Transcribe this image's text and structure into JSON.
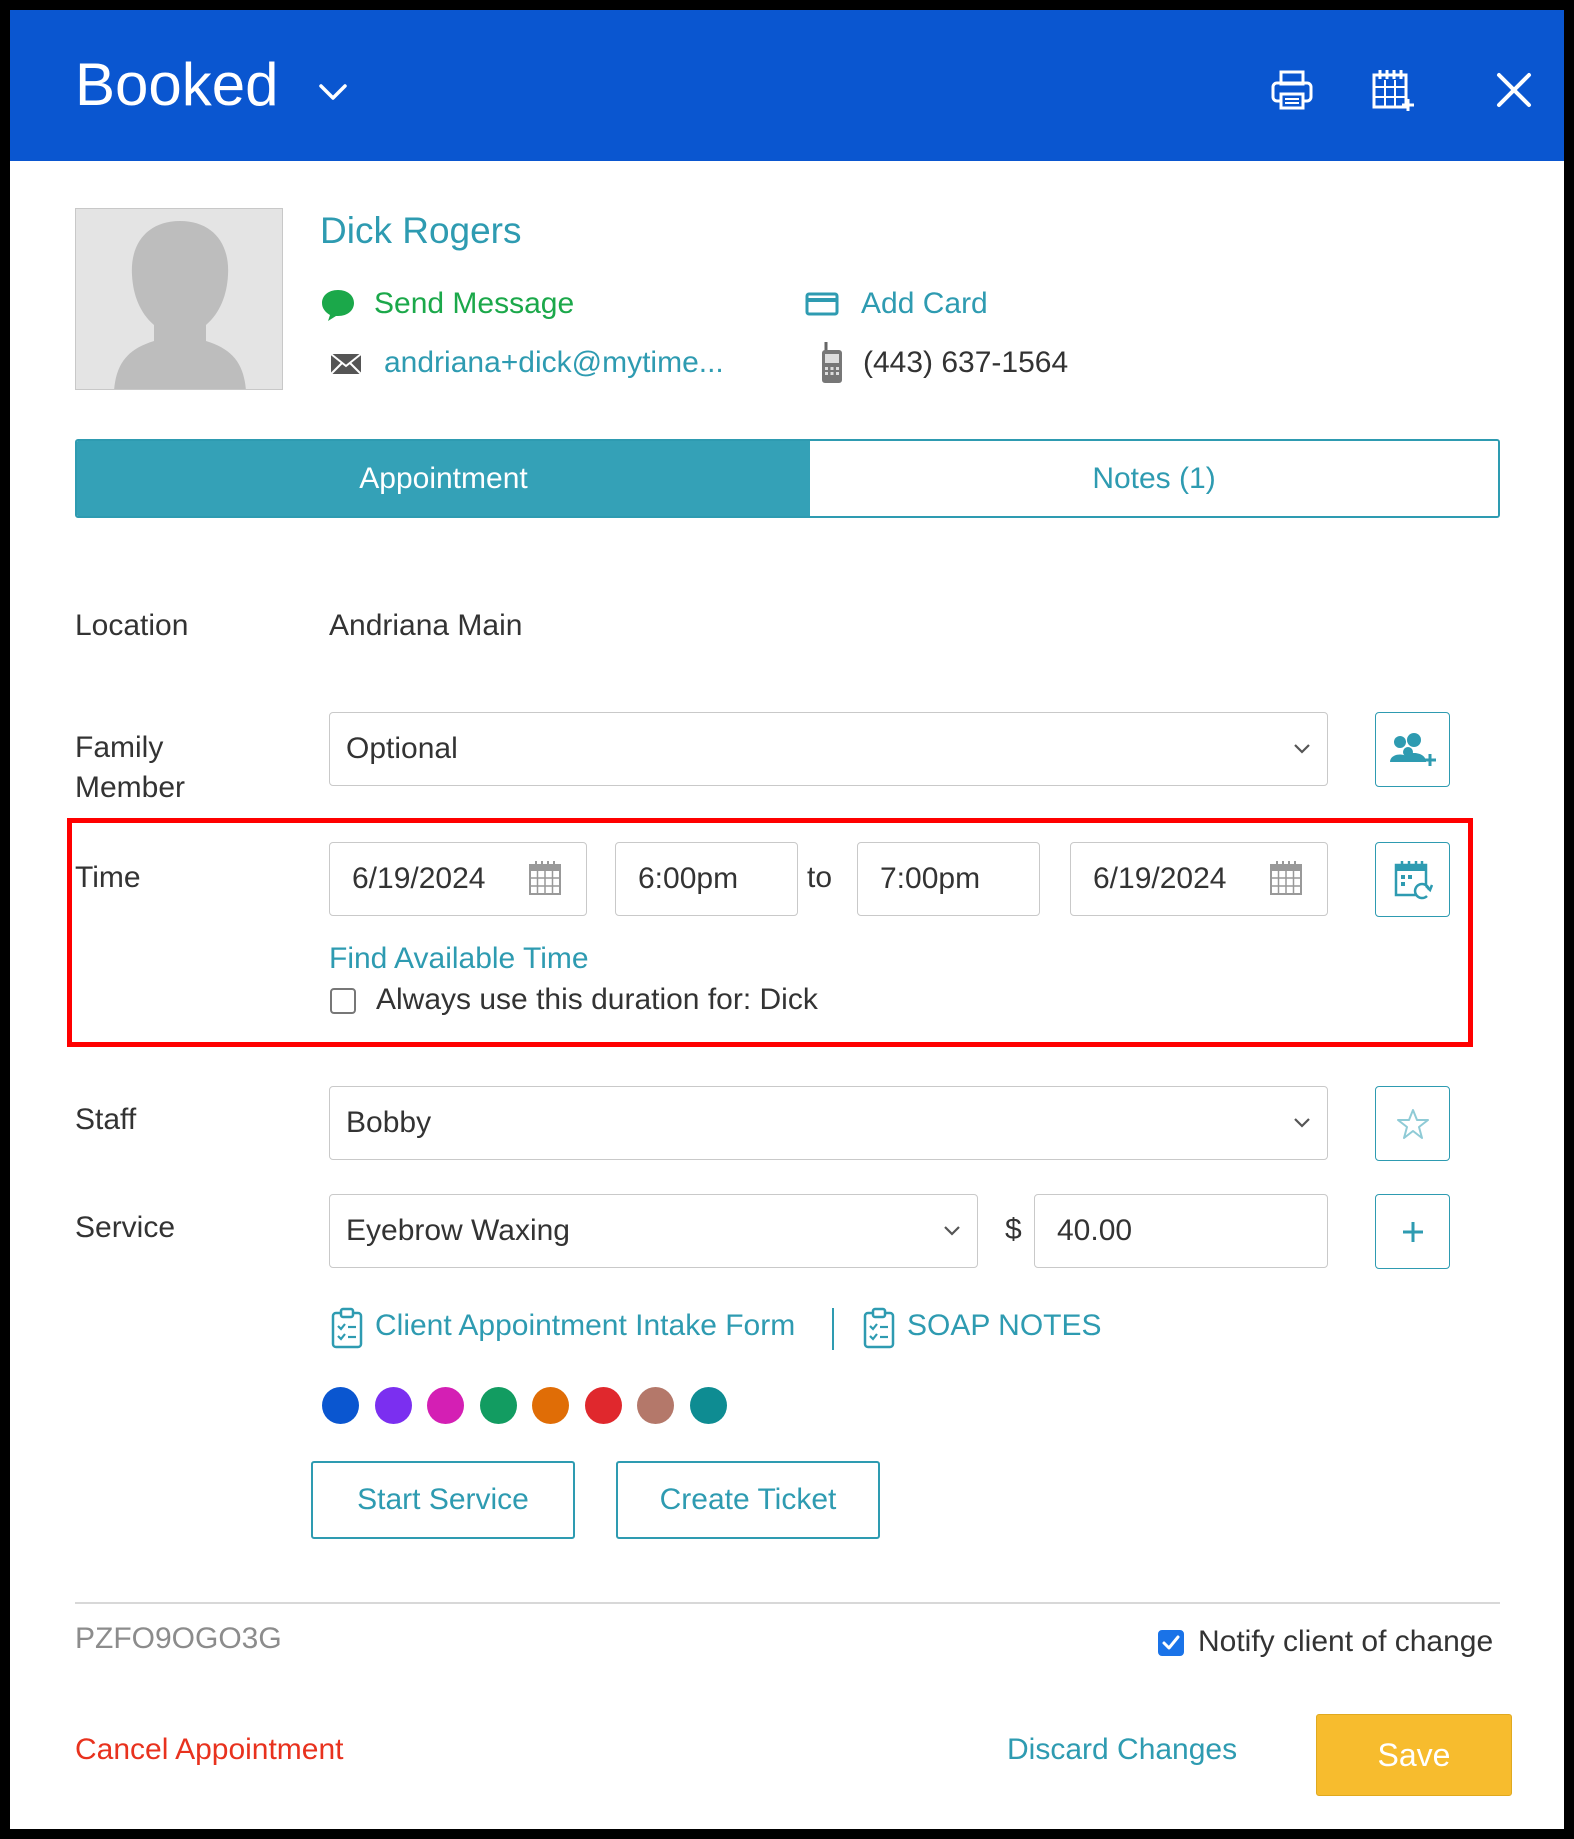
{
  "header": {
    "status": "Booked",
    "icons": [
      "chevron-down-icon",
      "print-icon",
      "calendar-add-icon",
      "close-icon"
    ]
  },
  "client": {
    "name": "Dick Rogers",
    "send_message": "Send Message",
    "add_card": "Add Card",
    "email": "andriana+dick@mytime...",
    "phone": "(443) 637-1564"
  },
  "tabs": [
    {
      "label": "Appointment",
      "active": true
    },
    {
      "label": "Notes (1)",
      "active": false
    }
  ],
  "form": {
    "location_label": "Location",
    "location_value": "Andriana Main",
    "family_label_1": "Family",
    "family_label_2": "Member",
    "family_value": "Optional",
    "time_label": "Time",
    "start_date": "6/19/2024",
    "start_time": "6:00pm",
    "to": "to",
    "end_time": "7:00pm",
    "end_date": "6/19/2024",
    "find_time": "Find Available Time",
    "always_duration": "Always use this duration for: Dick",
    "always_duration_checked": false,
    "staff_label": "Staff",
    "staff_value": "Bobby",
    "service_label": "Service",
    "service_value": "Eyebrow Waxing",
    "currency": "$",
    "price": "40.00",
    "intake_form": "Client Appointment Intake Form",
    "soap_notes": "SOAP NOTES"
  },
  "colors": [
    "#0a56d0",
    "#7b2ff0",
    "#d41fb4",
    "#129c61",
    "#e06d06",
    "#e0282d",
    "#b4786a",
    "#0e8c92"
  ],
  "actions": {
    "start_service": "Start Service",
    "create_ticket": "Create Ticket"
  },
  "footer": {
    "ref_code": "PZFO9OGO3G",
    "notify": "Notify client of change",
    "notify_checked": true,
    "cancel": "Cancel Appointment",
    "discard": "Discard Changes",
    "save": "Save"
  },
  "theme": {
    "header_bg": "#0a56d0",
    "accent": "#2e9bb1",
    "message_green": "#1ba84a",
    "cancel_red": "#e8321e",
    "save_yellow": "#f7bc2e",
    "highlight_red": "#ff0000"
  }
}
